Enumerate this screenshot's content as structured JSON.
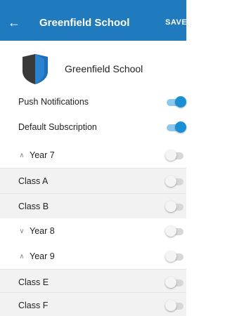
{
  "header": {
    "back_icon": "arrow-left-icon",
    "title": "Greenfield School",
    "action_label": "SAVE"
  },
  "school": {
    "logo_icon": "shield-logo",
    "name": "Greenfield School"
  },
  "settings": [
    {
      "label": "Push Notifications",
      "on": true
    },
    {
      "label": "Default Subscription",
      "on": true
    }
  ],
  "groups": [
    {
      "chevron": "^",
      "label": "Year 7",
      "on": false,
      "expanded": true
    },
    {
      "label": "Class A",
      "on": false
    },
    {
      "label": "Class B",
      "on": false
    },
    {
      "chevron": "v",
      "label": "Year 8",
      "on": false,
      "expanded": false
    },
    {
      "chevron": "^",
      "label": "Year 9",
      "on": false,
      "expanded": true
    },
    {
      "label": "Class E",
      "on": false
    },
    {
      "label": "Class F",
      "on": false
    }
  ],
  "colors": {
    "appbar": "#1f7bbd",
    "toggle_on": "#1b8fd6",
    "shaded_row": "#f2f2f2"
  }
}
